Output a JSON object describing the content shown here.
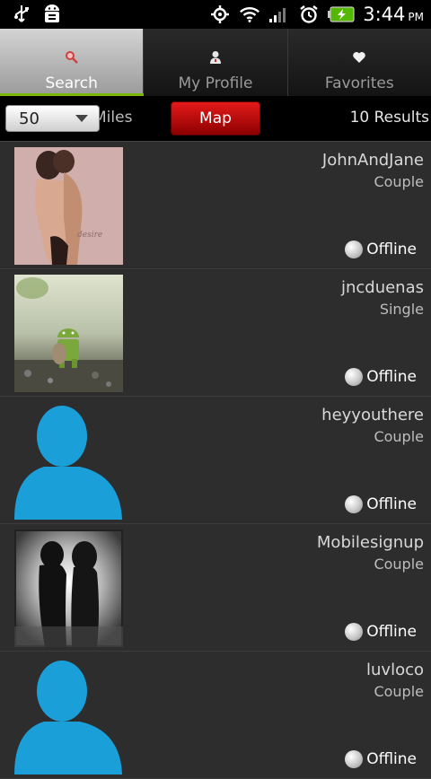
{
  "status_bar": {
    "time": "3:44",
    "ampm": "PM",
    "icons_left": [
      "usb-icon",
      "android-debug-icon"
    ],
    "icons_right": [
      "gps-icon",
      "wifi-icon",
      "signal-icon",
      "alarm-icon",
      "battery-icon"
    ]
  },
  "tabs": [
    {
      "label": "Search",
      "icon": "search-icon",
      "active": true
    },
    {
      "label": "My Profile",
      "icon": "person-icon",
      "active": false
    },
    {
      "label": "Favorites",
      "icon": "heart-icon",
      "active": false
    }
  ],
  "filter": {
    "distance_value": "50",
    "distance_unit": "Miles",
    "map_label": "Map",
    "results_text": "10 Results"
  },
  "colors": {
    "map_button": "#c80000",
    "avatar_placeholder": "#1a9fd8",
    "background": "#2d2d2d"
  },
  "profiles": [
    {
      "username": "JohnAndJane",
      "type": "Couple",
      "status": "Offline",
      "photo": "couple-photo-pink"
    },
    {
      "username": "jncduenas",
      "type": "Single",
      "status": "Offline",
      "photo": "android-figure-photo"
    },
    {
      "username": "heyyouthere",
      "type": "Couple",
      "status": "Offline",
      "photo": "default-avatar"
    },
    {
      "username": "Mobilesignup",
      "type": "Couple",
      "status": "Offline",
      "photo": "couple-silhouette-photo"
    },
    {
      "username": "luvloco",
      "type": "Couple",
      "status": "Offline",
      "photo": "default-avatar"
    }
  ]
}
